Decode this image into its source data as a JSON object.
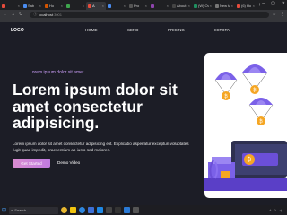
{
  "browser": {
    "tabs": [
      {
        "label": "",
        "color": "#e74c3c",
        "active": false
      },
      {
        "label": "Sab",
        "color": "#4a8cf0",
        "active": false
      },
      {
        "label": "Ho",
        "color": "#d35400",
        "active": false
      },
      {
        "label": "",
        "color": "#3ea64d",
        "active": false
      },
      {
        "label": "A",
        "color": "#e74c3c",
        "active": true
      },
      {
        "label": "",
        "color": "#4a8cf0",
        "active": false
      },
      {
        "label": "Pro",
        "color": "#555555",
        "active": false
      },
      {
        "label": "",
        "color": "#8e44ad",
        "active": false
      },
      {
        "label": "About",
        "color": "#444444",
        "active": false
      },
      {
        "label": "(W) Ou",
        "color": "#1f8f5f",
        "active": false
      },
      {
        "label": "New tab",
        "color": "#777777",
        "active": false
      },
      {
        "label": "(6) Ho",
        "color": "#e74c3c",
        "active": false
      }
    ],
    "new_tab": "+",
    "url_host": "localhost",
    "url_port": ":3001"
  },
  "site": {
    "logo": "LOGO",
    "nav": [
      "HOME",
      "SEND",
      "PRICING",
      "HISTORY"
    ],
    "eyebrow": "Lorem ipsum dolor sit amet.",
    "headline": "Lorem ipsum dolor sit amet consectetur adipisicing.",
    "paragraph": "Lorem ipsum dolor sit amet consectetur adipisicing elit. Explicabo asperiatur excepturi voluptates fugit quae impedit, praesentium ab iusto sed maiores.",
    "primary_button": "Get Started",
    "secondary_button": "Demo Video",
    "colors": {
      "background": "#1c1d26",
      "accent": "#c89cf5",
      "parachute": "#7b61e8",
      "coin": "#f5a623"
    }
  },
  "taskbar": {
    "search_placeholder": "Search",
    "time": "",
    "date": ""
  }
}
